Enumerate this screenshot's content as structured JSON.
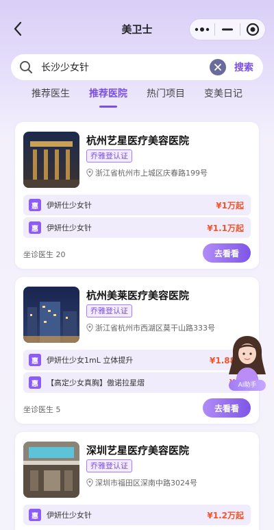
{
  "app": {
    "title": "美卫士"
  },
  "search": {
    "value": "长沙少女针",
    "button_label": "搜索"
  },
  "tabs": [
    {
      "label": "推荐医生",
      "active": false
    },
    {
      "label": "推荐医院",
      "active": true
    },
    {
      "label": "热门项目",
      "active": false
    },
    {
      "label": "变美日记",
      "active": false
    }
  ],
  "hospitals": [
    {
      "name": "杭州艺星医疗美容医院",
      "badge": "乔雅登认证",
      "address": "浙江省杭州市上城区庆春路199号",
      "items": [
        {
          "tag": "惠",
          "name": "伊妍仕少女针",
          "price": "¥1万起"
        },
        {
          "tag": "惠",
          "name": "伊妍仕少女针",
          "price": "¥1.1万起"
        }
      ],
      "doctors": "坐诊医生 20",
      "button": "去看看"
    },
    {
      "name": "杭州美莱医疗美容医院",
      "badge": "乔雅登认证",
      "address": "浙江省杭州市西湖区莫干山路333号",
      "items": [
        {
          "tag": "惠",
          "name": "伊妍仕少女1mL 立体提升",
          "price": "¥1.88万"
        },
        {
          "tag": "惠",
          "name": "【高定少女真胸】傲诺拉星熠",
          "price": "¥6."
        }
      ],
      "doctors": "坐诊医生 5",
      "button": "去看看"
    },
    {
      "name": "深圳艺星医疗美容医院",
      "badge": "乔雅登认证",
      "address": "深圳市福田区深南中路3024号",
      "items": [
        {
          "tag": "惠",
          "name": "伊妍仕少女针",
          "price": "¥1.2万起"
        }
      ]
    }
  ],
  "ai_assistant": {
    "label": "AI助手"
  },
  "colors": {
    "accent": "#7b4fe0",
    "price": "#f0552c",
    "badge_bg": "#f3ecff"
  }
}
